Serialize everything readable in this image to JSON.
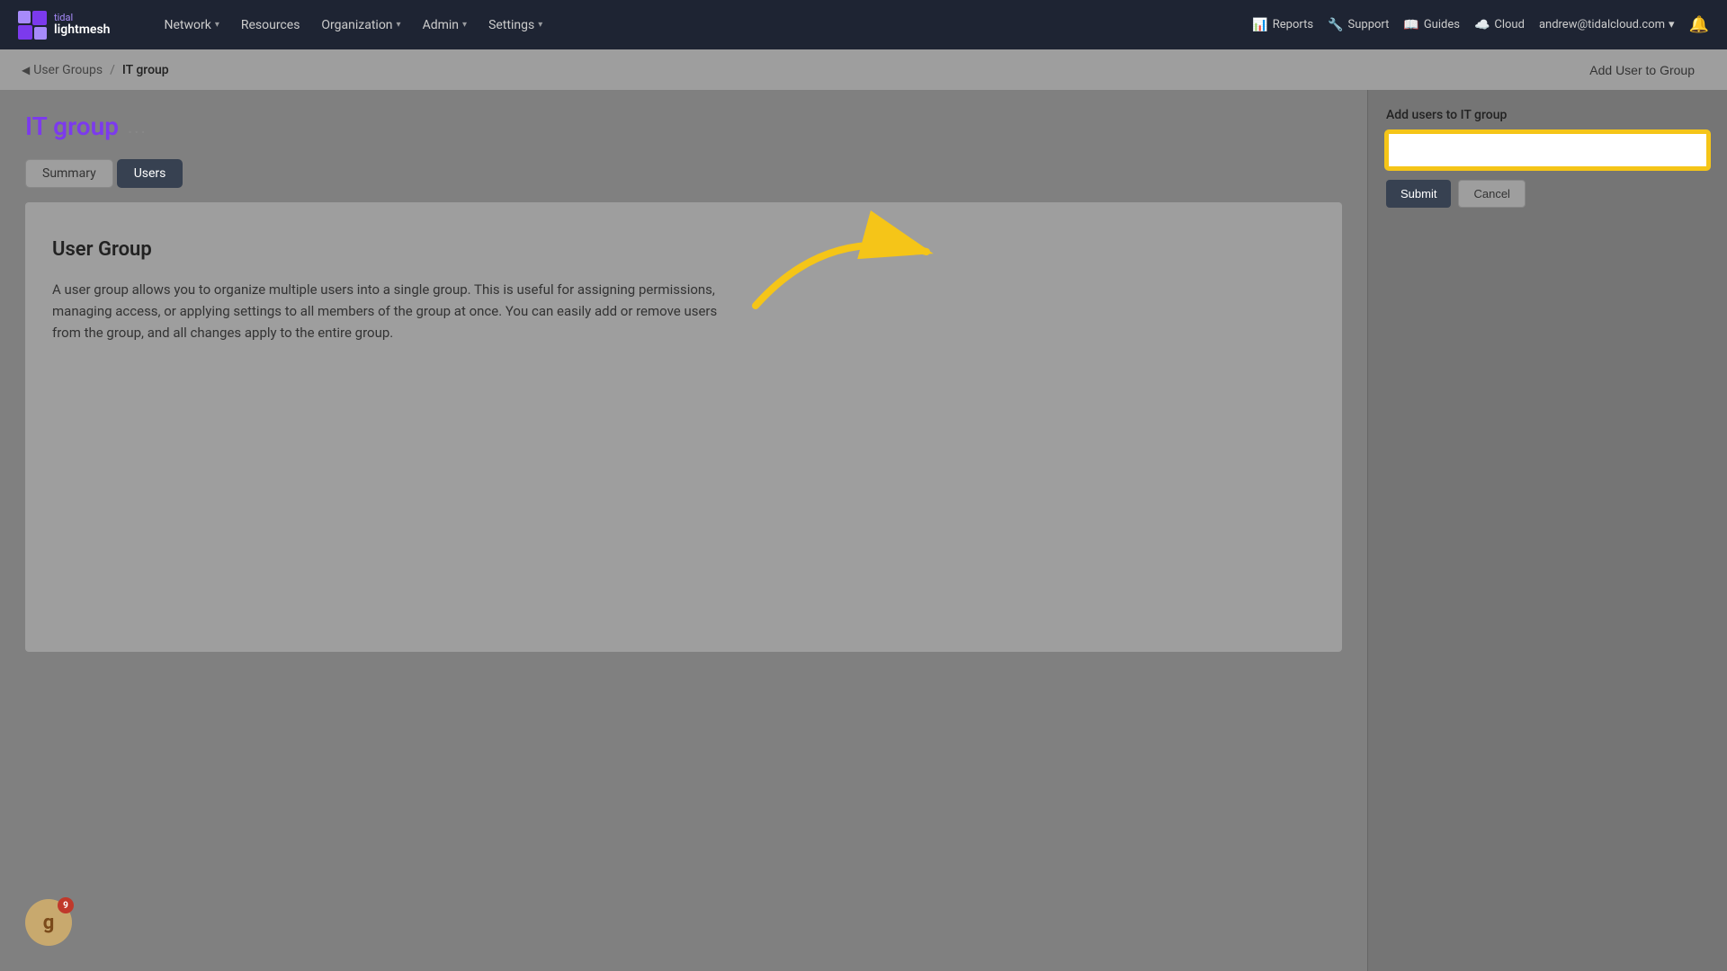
{
  "app": {
    "logo_top": "tidal",
    "logo_bottom": "lightmesh"
  },
  "nav": {
    "items": [
      {
        "label": "Network",
        "has_dropdown": true
      },
      {
        "label": "Resources",
        "has_dropdown": false
      },
      {
        "label": "Organization",
        "has_dropdown": true
      },
      {
        "label": "Admin",
        "has_dropdown": true
      },
      {
        "label": "Settings",
        "has_dropdown": true
      }
    ],
    "right_items": [
      {
        "label": "Reports",
        "icon": "📊"
      },
      {
        "label": "Support",
        "icon": "🔧"
      },
      {
        "label": "Guides",
        "icon": "📖"
      },
      {
        "label": "Cloud",
        "icon": "☁️"
      }
    ],
    "user_email": "andrew@tidalcloud.com"
  },
  "breadcrumb": {
    "back_label": "User Groups",
    "current_label": "IT group"
  },
  "header": {
    "add_user_button": "Add User to Group"
  },
  "page": {
    "title": "IT group",
    "more_dots": "...",
    "tabs": [
      {
        "label": "Summary",
        "active": false
      },
      {
        "label": "Users",
        "active": true
      }
    ]
  },
  "content": {
    "user_group_title": "User Group",
    "user_group_desc": "A user group allows you to organize multiple users into a single group. This is useful for assigning permissions, managing access, or applying settings to all members of the group at once. You can easily add or remove users from the group, and all changes apply to the entire group."
  },
  "sidebar": {
    "label": "Add users to IT group",
    "input_placeholder": "",
    "submit_label": "Submit",
    "cancel_label": "Cancel"
  },
  "avatar": {
    "letter": "g",
    "badge_count": "9"
  }
}
